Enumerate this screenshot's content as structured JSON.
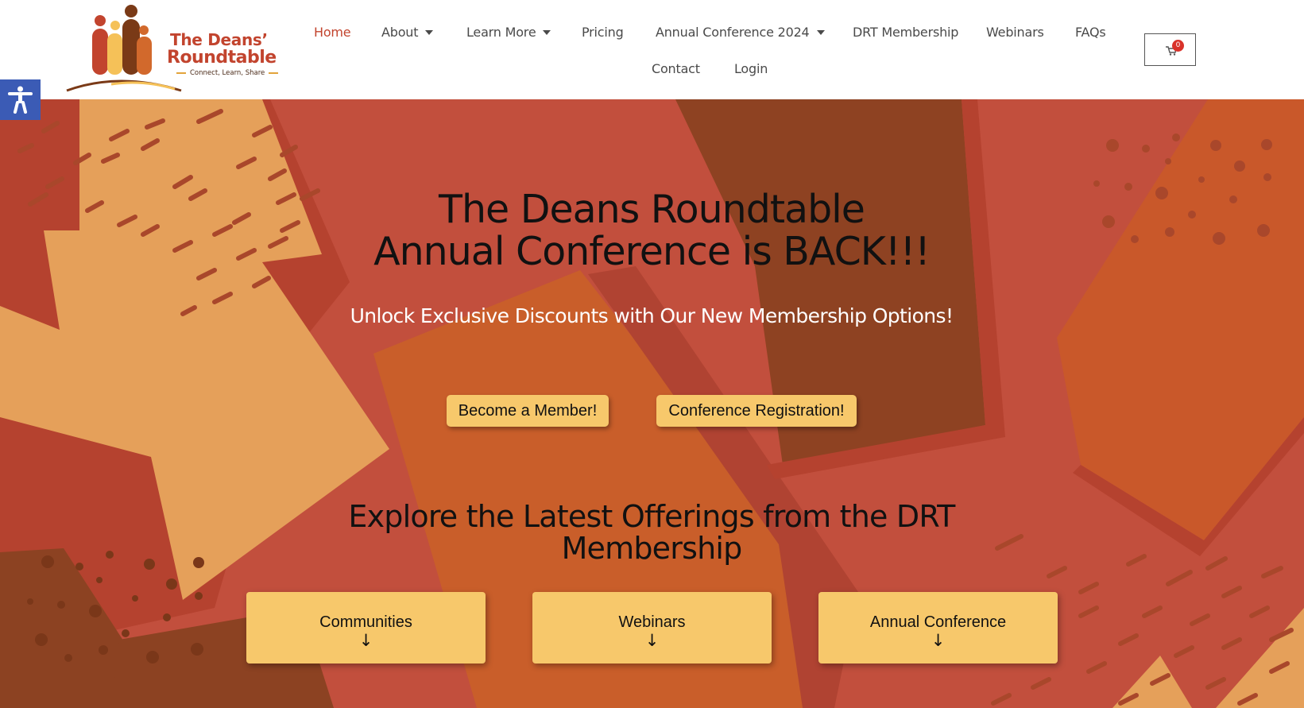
{
  "logo": {
    "line1": "The Deans’",
    "line2": "Roundtable",
    "tagline": "Connect, Learn, Share"
  },
  "nav": {
    "items": [
      {
        "label": "Home",
        "active": true
      },
      {
        "label": "About",
        "dropdown": true
      },
      {
        "label": "Learn More",
        "dropdown": true
      },
      {
        "label": "Pricing"
      },
      {
        "label": "Annual Conference 2024",
        "dropdown": true
      },
      {
        "label": "DRT Membership"
      },
      {
        "label": "Webinars"
      },
      {
        "label": "FAQs"
      },
      {
        "label": "Contact"
      },
      {
        "label": "Login"
      }
    ]
  },
  "cart": {
    "count": "0",
    "icon": "cart-icon"
  },
  "accessibility": {
    "icon": "accessibility-icon"
  },
  "hero": {
    "title_line1": "The Deans Roundtable",
    "title_line2": "Annual Conference is BACK!!!",
    "subtitle": "Unlock Exclusive Discounts with Our New Membership Options!",
    "buttons": {
      "member": "Become a Member!",
      "conference": "Conference Registration!"
    },
    "explore_title": "Explore the Latest Offerings from the DRT Membership",
    "cards": [
      {
        "label": "Communities",
        "arrow": "↓"
      },
      {
        "label": "Webinars",
        "arrow": "↓"
      },
      {
        "label": "Annual Conference",
        "arrow": "↓"
      }
    ]
  },
  "colors": {
    "brand": "#c2442e",
    "button": "#f7c86b",
    "hero_bg": "#c24f3d",
    "accessibility_bg": "#3b5bb5"
  }
}
